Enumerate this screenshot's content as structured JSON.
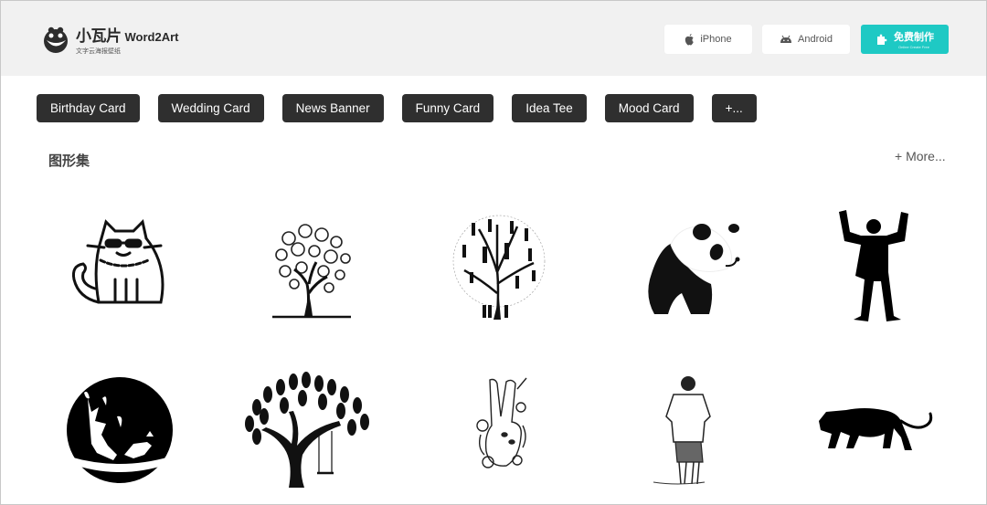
{
  "header": {
    "logo": {
      "cn_name": "小瓦片",
      "en_name": "Word2Art",
      "subtitle": "文字云海报壁纸",
      "icon": "smiley-logo-icon"
    },
    "buttons": [
      {
        "label": "iPhone",
        "icon": "apple-icon"
      },
      {
        "label": "Android",
        "icon": "android-icon"
      },
      {
        "label": "免费制作",
        "sublabel": "Online Create Free",
        "icon": "puzzle-icon",
        "color": "#1ec9c4"
      }
    ]
  },
  "categories": [
    {
      "label": "Birthday Card"
    },
    {
      "label": "Wedding Card"
    },
    {
      "label": "News Banner"
    },
    {
      "label": "Funny Card"
    },
    {
      "label": "Idea Tee"
    },
    {
      "label": "Mood Card"
    },
    {
      "label": "+..."
    }
  ],
  "section": {
    "title": "图形集",
    "more_label": "+ More..."
  },
  "shapes": [
    {
      "name": "cat-with-sunglasses"
    },
    {
      "name": "tree-of-faces"
    },
    {
      "name": "tree-of-people"
    },
    {
      "name": "panda"
    },
    {
      "name": "cheering-man"
    },
    {
      "name": "deer-kiss-circle"
    },
    {
      "name": "tree-with-swing"
    },
    {
      "name": "peace-hand-flowers"
    },
    {
      "name": "man-standing-back"
    },
    {
      "name": "panther"
    }
  ],
  "colors": {
    "accent": "#1ec9c4",
    "category_bg": "#2f2f2f",
    "header_bg": "#f1f1f1"
  }
}
